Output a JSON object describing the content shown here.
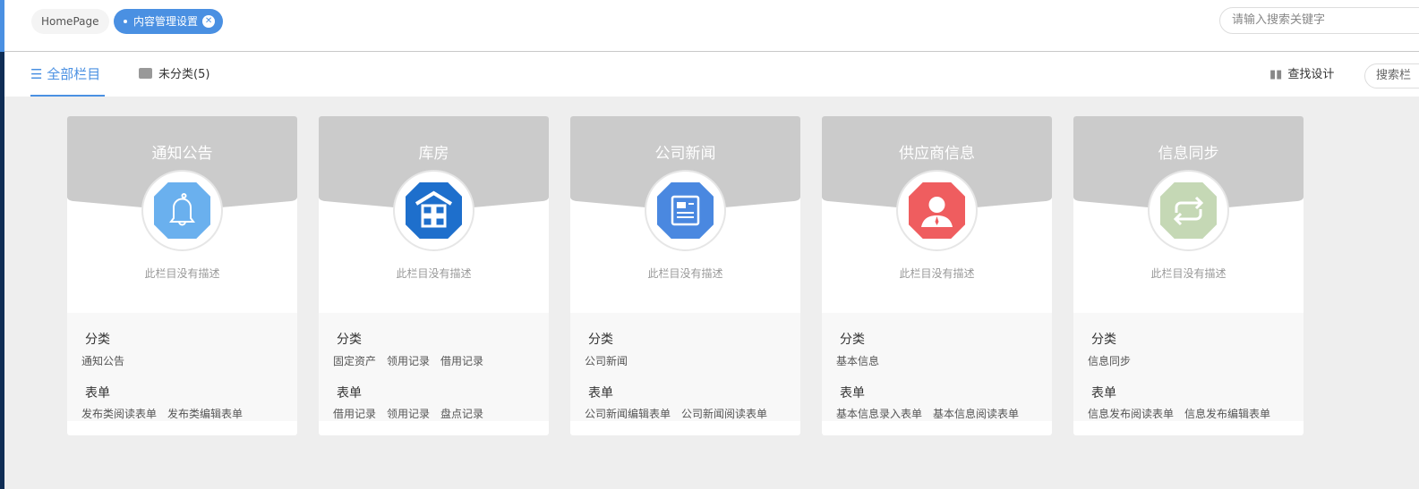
{
  "tabs_bar": {
    "home": "HomePage",
    "active": "内容管理设置",
    "search_placeholder": "请输入搜索关键字"
  },
  "sub_tabs": {
    "all": "全部栏目",
    "uncat": "未分类(5)",
    "find_design": "查找设计",
    "search_btn": "搜索栏"
  },
  "colors": {
    "accent": "#4a90e2",
    "header_grey": "#cbcbcb"
  },
  "cards": [
    {
      "title": "通知公告",
      "icon": "bell-icon",
      "color": "#6ab0ee",
      "desc": "此栏目没有描述",
      "cat_label": "分类",
      "cats": [
        "通知公告"
      ],
      "form_label": "表单",
      "forms": [
        "发布类阅读表单",
        "发布类编辑表单"
      ]
    },
    {
      "title": "库房",
      "icon": "warehouse-icon",
      "color": "#1e6fcc",
      "desc": "此栏目没有描述",
      "cat_label": "分类",
      "cats": [
        "固定资产",
        "领用记录",
        "借用记录"
      ],
      "form_label": "表单",
      "forms": [
        "借用记录",
        "领用记录",
        "盘点记录"
      ]
    },
    {
      "title": "公司新闻",
      "icon": "news-icon",
      "color": "#4a88e0",
      "desc": "此栏目没有描述",
      "cat_label": "分类",
      "cats": [
        "公司新闻"
      ],
      "form_label": "表单",
      "forms": [
        "公司新闻编辑表单",
        "公司新闻阅读表单"
      ]
    },
    {
      "title": "供应商信息",
      "icon": "person-icon",
      "color": "#ef5d5f",
      "desc": "此栏目没有描述",
      "cat_label": "分类",
      "cats": [
        "基本信息"
      ],
      "form_label": "表单",
      "forms": [
        "基本信息录入表单",
        "基本信息阅读表单"
      ]
    },
    {
      "title": "信息同步",
      "icon": "sync-icon",
      "color": "#c5d8b5",
      "desc": "此栏目没有描述",
      "cat_label": "分类",
      "cats": [
        "信息同步"
      ],
      "form_label": "表单",
      "forms": [
        "信息发布阅读表单",
        "信息发布编辑表单"
      ]
    }
  ]
}
